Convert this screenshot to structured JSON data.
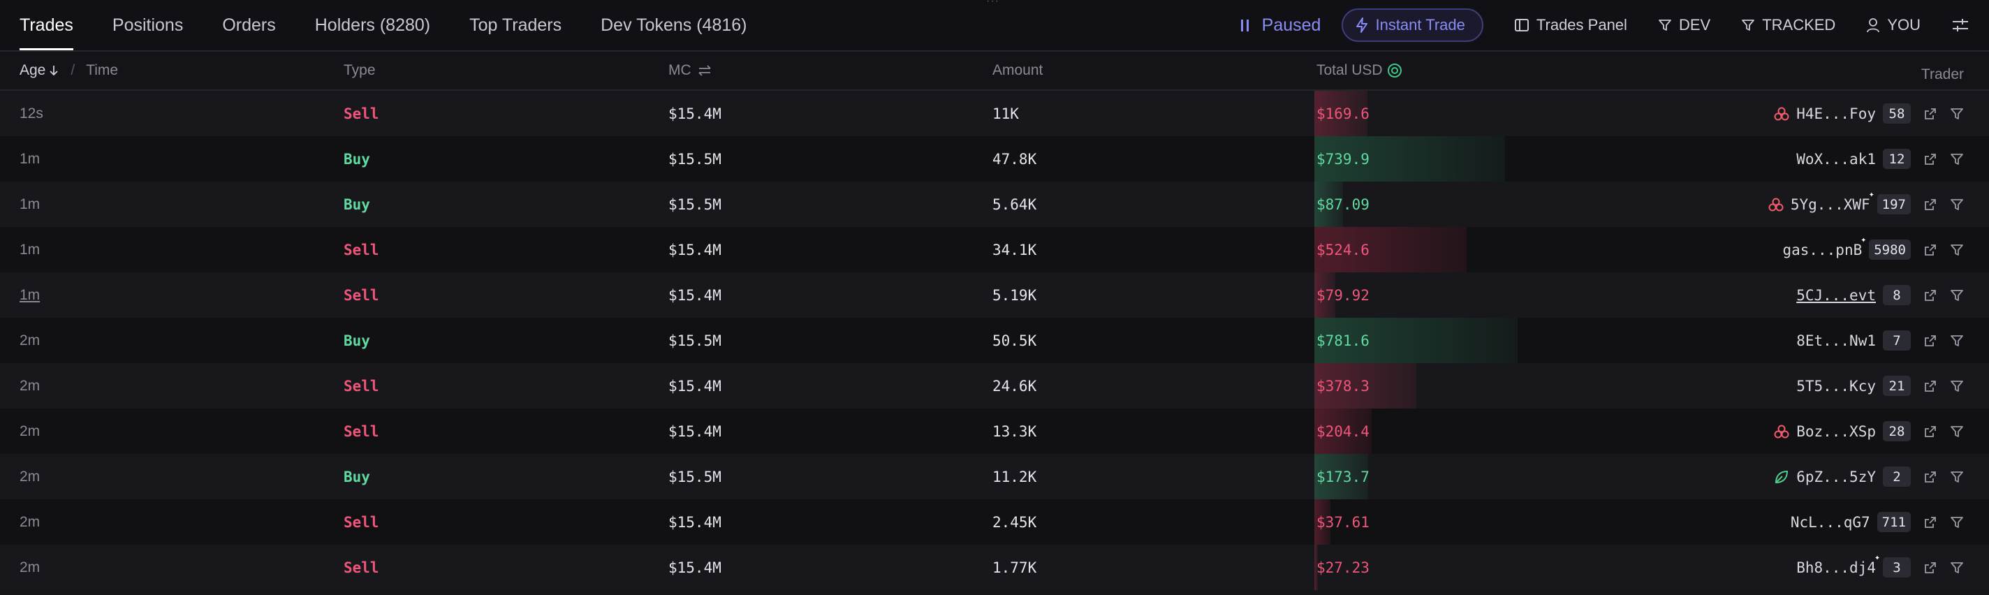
{
  "tabs": [
    {
      "label": "Trades",
      "active": true
    },
    {
      "label": "Positions"
    },
    {
      "label": "Orders"
    },
    {
      "label": "Holders (8280)"
    },
    {
      "label": "Top Traders"
    },
    {
      "label": "Dev Tokens (4816)"
    }
  ],
  "controls": {
    "paused_label": "Paused",
    "instant_trade_label": "Instant Trade",
    "trades_panel_label": "Trades Panel",
    "dev_label": "DEV",
    "tracked_label": "TRACKED",
    "you_label": "YOU"
  },
  "columns": {
    "age": "Age",
    "time": "Time",
    "type": "Type",
    "mc": "MC",
    "amount": "Amount",
    "total_usd": "Total USD",
    "trader": "Trader"
  },
  "colors": {
    "sell": "#f0557a",
    "buy": "#5fdaa0",
    "accent": "#8a8cf5"
  },
  "rows": [
    {
      "age": "12s",
      "type": "Sell",
      "mc": "$15.4M",
      "amount": "11K",
      "total": "$169.6",
      "total_share": 0.083,
      "trader": "H4E...Foy",
      "count": "58",
      "icon": "badge-red-icon",
      "spark": false
    },
    {
      "age": "1m",
      "type": "Buy",
      "mc": "$15.5M",
      "amount": "47.8K",
      "total": "$739.9",
      "total_share": 0.3,
      "trader": "WoX...ak1",
      "count": "12",
      "icon": "",
      "spark": false
    },
    {
      "age": "1m",
      "type": "Buy",
      "mc": "$15.5M",
      "amount": "5.64K",
      "total": "$87.09",
      "total_share": 0.045,
      "trader": "5Yg...XWF",
      "count": "197",
      "icon": "badge-red-icon",
      "spark": true
    },
    {
      "age": "1m",
      "type": "Sell",
      "mc": "$15.4M",
      "amount": "34.1K",
      "total": "$524.6",
      "total_share": 0.24,
      "trader": "gas...pnB",
      "count": "5980",
      "icon": "",
      "spark": true
    },
    {
      "age": "1m",
      "type": "Sell",
      "mc": "$15.4M",
      "amount": "5.19K",
      "total": "$79.92",
      "total_share": 0.033,
      "trader": "5CJ...evt",
      "count": "8",
      "icon": "",
      "spark": false,
      "underline": true
    },
    {
      "age": "2m",
      "type": "Buy",
      "mc": "$15.5M",
      "amount": "50.5K",
      "total": "$781.6",
      "total_share": 0.32,
      "trader": "8Et...Nw1",
      "count": "7",
      "icon": "",
      "spark": false
    },
    {
      "age": "2m",
      "type": "Sell",
      "mc": "$15.4M",
      "amount": "24.6K",
      "total": "$378.3",
      "total_share": 0.16,
      "trader": "5T5...Kcy",
      "count": "21",
      "icon": "",
      "spark": false
    },
    {
      "age": "2m",
      "type": "Sell",
      "mc": "$15.4M",
      "amount": "13.3K",
      "total": "$204.4",
      "total_share": 0.09,
      "trader": "Boz...XSp",
      "count": "28",
      "icon": "badge-red-icon",
      "spark": false
    },
    {
      "age": "2m",
      "type": "Buy",
      "mc": "$15.5M",
      "amount": "11.2K",
      "total": "$173.7",
      "total_share": 0.085,
      "trader": "6pZ...5zY",
      "count": "2",
      "icon": "leaf-icon",
      "spark": false
    },
    {
      "age": "2m",
      "type": "Sell",
      "mc": "$15.4M",
      "amount": "2.45K",
      "total": "$37.61",
      "total_share": 0.025,
      "trader": "NcL...qG7",
      "count": "711",
      "icon": "",
      "spark": false
    },
    {
      "age": "2m",
      "type": "Sell",
      "mc": "$15.4M",
      "amount": "1.77K",
      "total": "$27.23",
      "total_share": 0.006,
      "trader": "Bh8...dj4",
      "count": "3",
      "icon": "",
      "spark": true
    }
  ]
}
